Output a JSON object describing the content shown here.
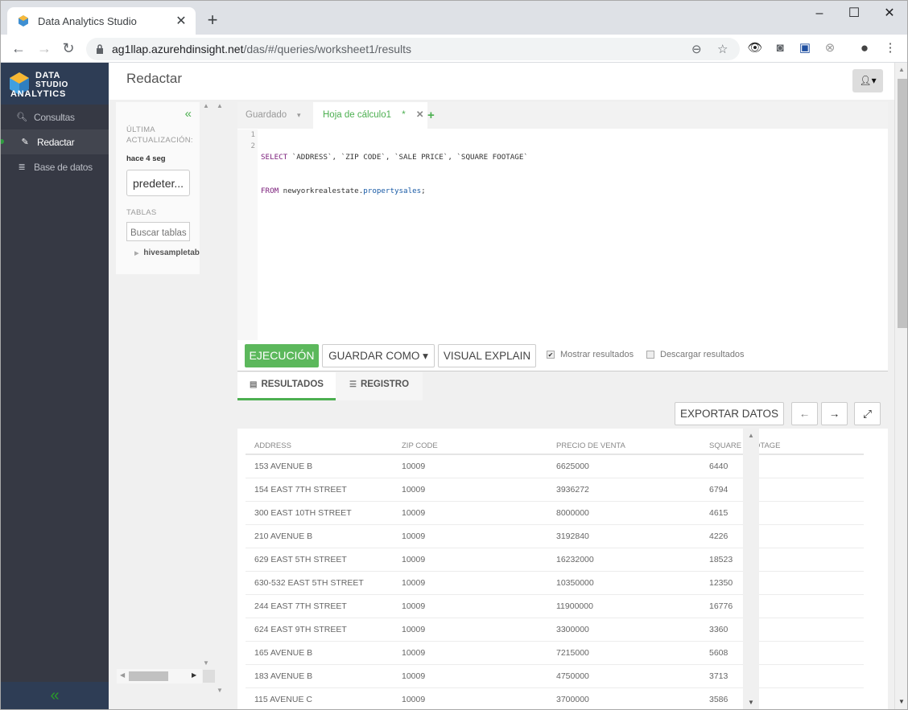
{
  "browser": {
    "tab_title": "Data Analytics Studio",
    "new_tab": "+",
    "url_host": "ag1llap.azurehdinsight.net",
    "url_path": "/das/#/queries/worksheet1/results",
    "window_controls": {
      "minimize": "–",
      "maximize": "☐",
      "close": "✕"
    },
    "nav": {
      "back": "←",
      "forward": "→",
      "reload": "↻"
    }
  },
  "app": {
    "logo": {
      "line1": "DATA",
      "line2": "STUDIO",
      "line3": "ANALYTICS"
    },
    "sidebar": {
      "items": [
        {
          "label": "Consultas",
          "icon": "search-icon",
          "active": false
        },
        {
          "label": "Redactar",
          "icon": "edit-icon",
          "active": true
        },
        {
          "label": "Base de datos",
          "icon": "database-icon",
          "active": false
        }
      ],
      "collapse": "«"
    },
    "header": {
      "title": "Redactar"
    },
    "db_panel": {
      "collapse": "«",
      "last_update_label_1": "ÚLTIMA",
      "last_update_label_2": "ACTUALIZACIÓN:",
      "last_update_value": "hace 4 seg",
      "database_select": "predeter...",
      "tables_label": "TABLAS",
      "tables_search_placeholder": "Buscar tablas",
      "tree_items": [
        "hivesampletable"
      ]
    },
    "editor": {
      "tabs": {
        "saved": "Guardado",
        "saved_caret": "▾",
        "active": "Hoja de cálculo1",
        "modified_marker": "*",
        "close": "✕",
        "add": "+"
      },
      "lines": [
        {
          "n": "1",
          "kw": "SELECT",
          "text": " `ADDRESS`, `ZIP CODE`, `SALE PRICE`, `SQUARE FOOTAGE`"
        },
        {
          "n": "2",
          "kw": "FROM",
          "text": " newyorkrealestate.",
          "fn": "propertysales",
          "end": ";"
        }
      ],
      "buttons": {
        "run": "EJECUCIÓN",
        "save_as": "GUARDAR COMO ▾",
        "visual_explain": "VISUAL EXPLAIN"
      },
      "options": {
        "show_results": {
          "label": "Mostrar resultados",
          "checked": true
        },
        "download_results": {
          "label": "Descargar resultados",
          "checked": false
        }
      }
    },
    "results": {
      "tabs": {
        "results": "RESULTADOS",
        "log": "REGISTRO"
      },
      "export": "EXPORTAR DATOS",
      "prev": "←",
      "next": "→",
      "expand": "⤢",
      "columns": [
        "ADDRESS",
        "ZIP CODE",
        "PRECIO DE VENTA",
        "SQUARE FOOTAGE"
      ],
      "rows": [
        [
          "153 AVENUE B",
          "10009",
          "6625000",
          "6440"
        ],
        [
          "154 EAST 7TH STREET",
          "10009",
          "3936272",
          "6794"
        ],
        [
          "300 EAST 10TH STREET",
          "10009",
          "8000000",
          "4615"
        ],
        [
          "210 AVENUE B",
          "10009",
          "3192840",
          "4226"
        ],
        [
          "629 EAST 5TH STREET",
          "10009",
          "16232000",
          "18523"
        ],
        [
          "630-532 EAST 5TH STREET",
          "10009",
          "10350000",
          "12350"
        ],
        [
          "244 EAST 7TH STREET",
          "10009",
          "11900000",
          "16776"
        ],
        [
          "624 EAST 9TH STREET",
          "10009",
          "3300000",
          "3360"
        ],
        [
          "165 AVENUE B",
          "10009",
          "7215000",
          "5608"
        ],
        [
          "183 AVENUE B",
          "10009",
          "4750000",
          "3713"
        ],
        [
          "115 AVENUE C",
          "10009",
          "3700000",
          "3586"
        ]
      ]
    }
  }
}
